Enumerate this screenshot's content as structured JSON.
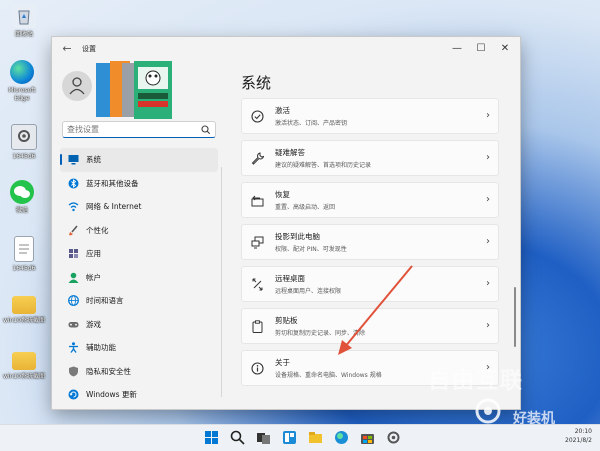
{
  "desktop": {
    "icons": [
      {
        "label": "回收站",
        "icon": "recycle-bin-icon"
      },
      {
        "label": "Microsoft Edge",
        "icon": "edge-icon"
      },
      {
        "label": "1645d6",
        "icon": "settings-shortcut-icon"
      },
      {
        "label": "微信",
        "icon": "wechat-icon"
      },
      {
        "label": "1645d6",
        "icon": "text-file-icon"
      },
      {
        "label": "win10系统截图",
        "icon": "folder-icon"
      },
      {
        "label": "win10系统截图",
        "icon": "folder-icon"
      }
    ]
  },
  "window": {
    "title": "设置",
    "controls": {
      "minimize": "—",
      "maximize": "☐",
      "close": "✕"
    }
  },
  "search": {
    "value": "",
    "placeholder": "查找设置"
  },
  "nav": {
    "items": [
      {
        "label": "系统",
        "icon": "monitor-icon",
        "active": true,
        "color": "#0063b1"
      },
      {
        "label": "蓝牙和其他设备",
        "icon": "bluetooth-icon",
        "active": false,
        "color": "#0078d4"
      },
      {
        "label": "网络 & Internet",
        "icon": "wifi-icon",
        "active": false,
        "color": "#0078d4"
      },
      {
        "label": "个性化",
        "icon": "brush-icon",
        "active": false,
        "color": "#e0643c"
      },
      {
        "label": "应用",
        "icon": "apps-icon",
        "active": false,
        "color": "#5a5a8a"
      },
      {
        "label": "帐户",
        "icon": "account-icon",
        "active": false,
        "color": "#1aa260"
      },
      {
        "label": "时间和语言",
        "icon": "globe-clock-icon",
        "active": false,
        "color": "#0078d4"
      },
      {
        "label": "游戏",
        "icon": "gamepad-icon",
        "active": false,
        "color": "#6b6b6b"
      },
      {
        "label": "辅助功能",
        "icon": "accessibility-icon",
        "active": false,
        "color": "#0078d4"
      },
      {
        "label": "隐私和安全性",
        "icon": "shield-icon",
        "active": false,
        "color": "#7a7a7a"
      },
      {
        "label": "Windows 更新",
        "icon": "update-icon",
        "active": false,
        "color": "#0078d4"
      }
    ]
  },
  "main": {
    "title": "系统",
    "cards": [
      {
        "title": "激活",
        "desc": "激活状态、订阅、产品密钥",
        "icon": "check-circle-icon"
      },
      {
        "title": "疑难解答",
        "desc": "建议的疑难解答、首选项和历史记录",
        "icon": "wrench-icon"
      },
      {
        "title": "恢复",
        "desc": "重置、高级启动、返回",
        "icon": "recovery-icon"
      },
      {
        "title": "投影到此电脑",
        "desc": "权限、配对 PIN、可发现性",
        "icon": "project-icon"
      },
      {
        "title": "远程桌面",
        "desc": "远程桌面用户、连接权限",
        "icon": "remote-desktop-icon"
      },
      {
        "title": "剪贴板",
        "desc": "剪切和复制历史记录、同步、清除",
        "icon": "clipboard-icon"
      },
      {
        "title": "关于",
        "desc": "设备规格、重命名电脑、Windows 规格",
        "icon": "info-icon"
      }
    ]
  },
  "taskbar": {
    "icons": [
      "windows-start-icon",
      "search-icon",
      "task-view-icon",
      "widgets-icon",
      "file-explorer-icon",
      "edge-icon",
      "store-icon",
      "settings-icon"
    ],
    "time": "20:10",
    "date": "2021/8/2"
  },
  "watermark": {
    "text": "自由互联",
    "brand": "好装机"
  },
  "colors": {
    "accent": "#005fb8",
    "arrow": "#e0523a"
  }
}
